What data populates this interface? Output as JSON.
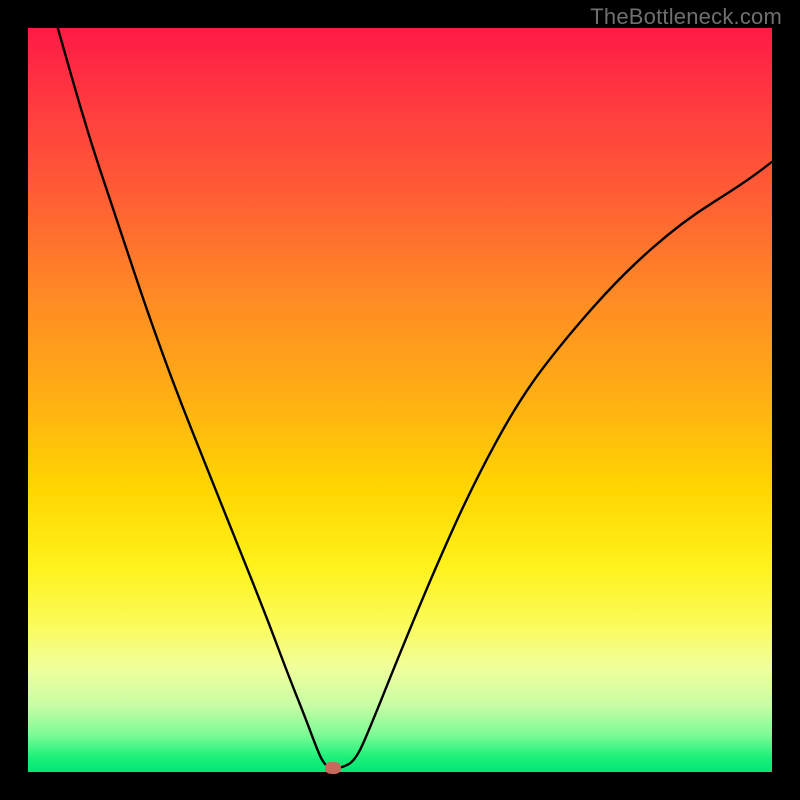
{
  "watermark": "TheBottleneck.com",
  "chart_data": {
    "type": "line",
    "title": "",
    "xlabel": "",
    "ylabel": "",
    "xlim": [
      0,
      100
    ],
    "ylim": [
      0,
      100
    ],
    "grid": false,
    "series": [
      {
        "name": "curve",
        "x": [
          4,
          8,
          12,
          16,
          20,
          24,
          28,
          32,
          35,
          37,
          38.5,
          39.5,
          40.5,
          42,
          44,
          46,
          50,
          55,
          60,
          66,
          72,
          80,
          88,
          96,
          100
        ],
        "y": [
          100,
          86,
          74,
          62,
          51,
          41,
          31,
          21,
          13,
          8,
          4,
          1.5,
          0.5,
          0.5,
          1.5,
          6,
          16,
          28,
          39,
          50,
          58,
          67,
          74,
          79,
          82
        ]
      }
    ],
    "marker": {
      "x": 41,
      "y": 0.5
    },
    "colors": {
      "curve": "#000000",
      "marker": "#c66a5e",
      "gradient_top": "#ff1a45",
      "gradient_bottom": "#00e676"
    }
  }
}
